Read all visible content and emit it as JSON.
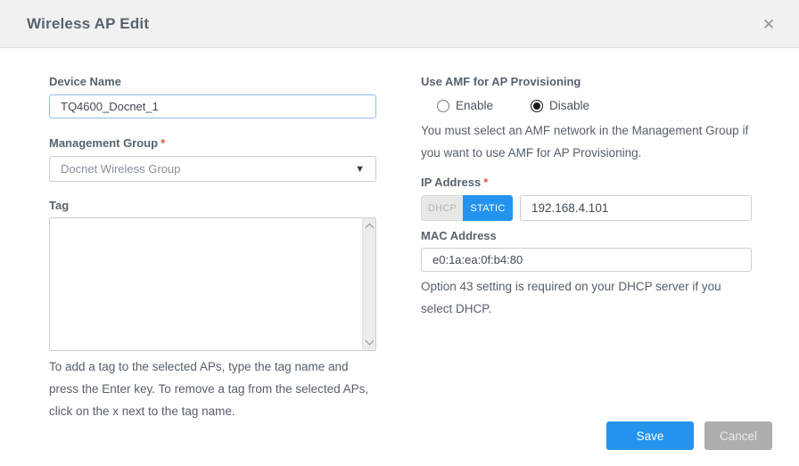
{
  "dialog": {
    "title": "Wireless AP Edit",
    "close_glyph": "✕"
  },
  "form": {
    "device_name": {
      "label": "Device Name",
      "value": "TQ4600_Docnet_1"
    },
    "management_group": {
      "label": "Management Group",
      "required_mark": "*",
      "selected_value": "Docnet Wireless Group",
      "caret_glyph": "▼"
    },
    "tag": {
      "label": "Tag",
      "value": "",
      "help": "To add a tag to the selected APs, type the tag name and press the Enter key. To remove a tag from the selected APs, click on the x next to the tag name."
    },
    "amf": {
      "label": "Use AMF for AP Provisioning",
      "options": [
        {
          "label": "Enable",
          "selected": false
        },
        {
          "label": "Disable",
          "selected": true
        }
      ],
      "help": "You must select an AMF network in the Management Group if you want to use AMF for AP Provisioning."
    },
    "ip_address": {
      "label": "IP Address",
      "required_mark": "*",
      "mode_dhcp_label": "DHCP",
      "mode_static_label": "STATIC",
      "selected_mode": "STATIC",
      "value": "192.168.4.101"
    },
    "mac_address": {
      "label": "MAC Address",
      "value": "e0:1a:ea:0f:b4:80",
      "help": "Option 43 setting is required on your DHCP server if you select DHCP."
    }
  },
  "footer": {
    "save_label": "Save",
    "cancel_label": "Cancel"
  },
  "colors": {
    "accent_blue": "#2493ee",
    "cancel_gray": "#aeaeae",
    "required_red": "#e2573b",
    "header_bg": "#f1f1f2"
  }
}
